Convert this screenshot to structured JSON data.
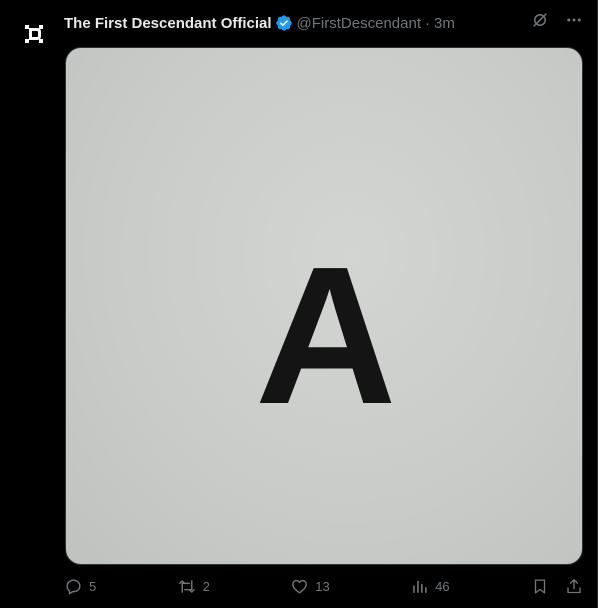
{
  "tweet": {
    "author": {
      "display_name": "The First Descendant Official",
      "handle": "@FirstDescendant",
      "verified": true,
      "avatar_icon": "descendant-logo-icon",
      "avatar_glyph": "D"
    },
    "separator": "·",
    "time": "3m",
    "media": {
      "content_text": "A",
      "background_color": "#c9ccc9",
      "letter_color": "#141414"
    },
    "actions": {
      "replies": "5",
      "reposts": "2",
      "likes": "13",
      "views": "46"
    },
    "header_icons": [
      "grok-icon",
      "more-icon"
    ],
    "action_icons": [
      "reply-icon",
      "repost-icon",
      "like-icon",
      "views-icon",
      "bookmark-icon",
      "share-icon"
    ]
  },
  "colors": {
    "background": "#000000",
    "text_primary": "#e7e9ea",
    "text_secondary": "#71767b",
    "verified_blue": "#1d9bf0",
    "border": "#2f3336"
  }
}
